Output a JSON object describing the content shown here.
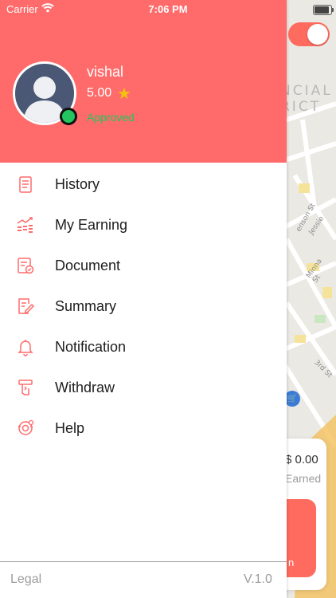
{
  "status_bar": {
    "carrier": "Carrier",
    "time": "7:06 PM"
  },
  "profile": {
    "name": "vishal",
    "rating": "5.00",
    "status": "Approved"
  },
  "menu": [
    {
      "label": "History",
      "icon": "history-icon"
    },
    {
      "label": "My Earning",
      "icon": "earning-icon"
    },
    {
      "label": "Document",
      "icon": "document-icon"
    },
    {
      "label": "Summary",
      "icon": "summary-icon"
    },
    {
      "label": "Notification",
      "icon": "bell-icon"
    },
    {
      "label": "Withdraw",
      "icon": "withdraw-icon"
    },
    {
      "label": "Help",
      "icon": "help-icon"
    }
  ],
  "footer": {
    "legal": "Legal",
    "version": "V.1.0"
  },
  "background": {
    "district_line1": "NCIAL",
    "district_line2": "RICT",
    "streets": [
      "enson St",
      "Jessie",
      "Minna St",
      "3rd St"
    ],
    "earnings_amount": "$ 0.00",
    "earnings_label": "Earned",
    "button_fragment": "n"
  },
  "colors": {
    "accent": "#ff6b6b",
    "online": "#22c55e",
    "star": "#f4c20d"
  }
}
